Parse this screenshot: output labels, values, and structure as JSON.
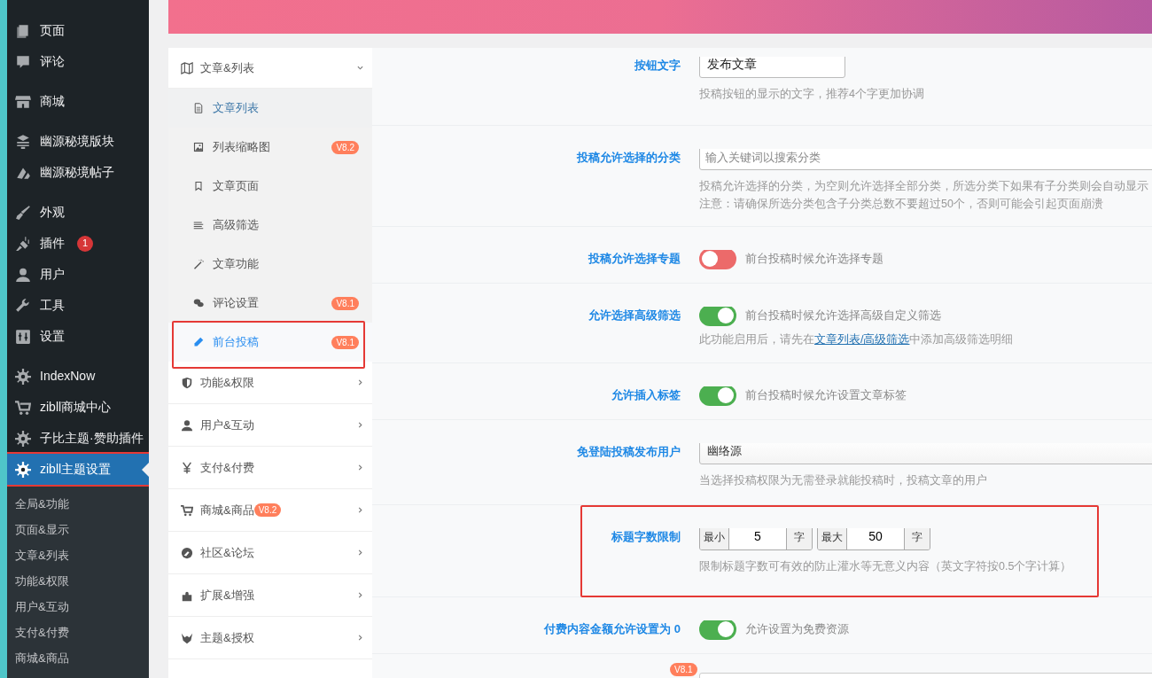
{
  "admin_menu": {
    "groups": [
      [
        {
          "label": "页面",
          "selected": false
        },
        {
          "label": "评论",
          "selected": false
        }
      ],
      [
        {
          "label": "商城",
          "selected": false
        }
      ],
      [
        {
          "label": "幽源秘境版块",
          "selected": false
        },
        {
          "label": "幽源秘境帖子",
          "selected": false
        }
      ],
      [
        {
          "label": "外观",
          "selected": false
        },
        {
          "label": "插件",
          "selected": false,
          "badge": "1"
        },
        {
          "label": "用户",
          "selected": false
        },
        {
          "label": "工具",
          "selected": false
        },
        {
          "label": "设置",
          "selected": false
        }
      ],
      [
        {
          "label": "IndexNow",
          "selected": false
        },
        {
          "label": "zibll商城中心",
          "selected": false
        },
        {
          "label": "子比主题·赞助插件",
          "selected": false
        },
        {
          "label": "zibll主题设置",
          "selected": true,
          "highlighted": true
        }
      ]
    ],
    "submenu": [
      "全局&功能",
      "页面&显示",
      "文章&列表",
      "功能&权限",
      "用户&互动",
      "支付&付费",
      "商城&商品"
    ]
  },
  "nav": [
    {
      "label": "文章&列表",
      "expanded": true,
      "children": [
        {
          "label": "文章列表",
          "selected": false,
          "hovered": true
        },
        {
          "label": "列表缩略图",
          "selected": false,
          "hovered": false,
          "badge": "V8.2"
        },
        {
          "label": "文章页面",
          "selected": false,
          "hovered": false
        },
        {
          "label": "高级筛选",
          "selected": false,
          "hovered": false
        },
        {
          "label": "文章功能",
          "selected": false,
          "hovered": false
        },
        {
          "label": "评论设置",
          "selected": false,
          "hovered": false,
          "badge": "V8.1"
        },
        {
          "label": "前台投稿",
          "selected": true,
          "hovered": false,
          "badge": "V8.1",
          "highlighted": true
        }
      ]
    },
    {
      "label": "功能&权限",
      "expanded": false
    },
    {
      "label": "用户&互动",
      "expanded": false
    },
    {
      "label": "支付&付费",
      "expanded": false
    },
    {
      "label": "商城&商品",
      "expanded": false,
      "badge": "V8.2"
    },
    {
      "label": "社区&论坛",
      "expanded": false
    },
    {
      "label": "扩展&增强",
      "expanded": false
    },
    {
      "label": "主题&授权",
      "expanded": false
    }
  ],
  "fields": [
    {
      "kind": "text",
      "label": "按钮文字",
      "value": "发布文章",
      "help": [
        "投稿按钮的显示的文字，推荐4个字更加协调"
      ]
    },
    {
      "kind": "search",
      "label": "投稿允许选择的分类",
      "placeholder": "输入关键词以搜索分类",
      "help": [
        "投稿允许选择的分类，为空则允许选择全部分类，所选分类下如果有子分类则会自动显示",
        "注意：请确保所选分类包含子分类总数不要超过50个，否则可能会引起页面崩溃"
      ]
    },
    {
      "kind": "toggle",
      "label": "投稿允许选择专题",
      "on": false,
      "text": "前台投稿时候允许选择专题"
    },
    {
      "kind": "toggle",
      "label": "允许选择高级筛选",
      "on": true,
      "text": "前台投稿时候允许选择高级自定义筛选",
      "help_parts": [
        {
          "text": "此功能启用后，请先在",
          "link": false
        },
        {
          "text": "文章列表/高级筛选",
          "link": true
        },
        {
          "text": "中添加高级筛选明细",
          "link": false
        }
      ]
    },
    {
      "kind": "toggle",
      "label": "允许插入标签",
      "on": true,
      "text": "前台投稿时候允许设置文章标签"
    },
    {
      "kind": "select",
      "label": "免登陆投稿发布用户",
      "value": "幽络源",
      "help": [
        "当选择投稿权限为无需登录就能投稿时，投稿文章的用户"
      ]
    },
    {
      "kind": "range",
      "label": "标题字数限制",
      "highlighted": true,
      "min_label": "最小",
      "min": "5",
      "min_unit": "字",
      "max_label": "最大",
      "max": "50",
      "max_unit": "字",
      "help": [
        "限制标题字数可有效的防止灌水等无意义内容（英文字符按0.5个字计算）"
      ]
    },
    {
      "kind": "toggle",
      "label": "付费内容金额允许设置为 0",
      "on": true,
      "text": "允许设置为免费资源"
    },
    {
      "kind": "clipped",
      "badge": "V8.1"
    }
  ]
}
